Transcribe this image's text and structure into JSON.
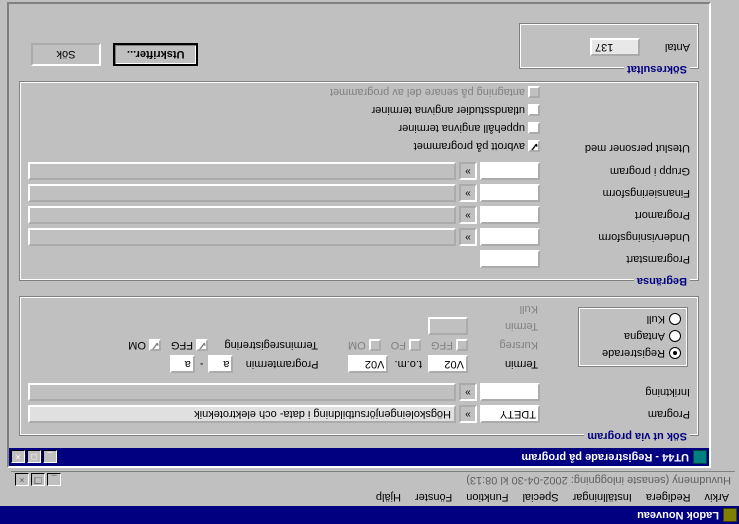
{
  "app": {
    "title": "Ladok Nouveau",
    "menu": [
      "Arkiv",
      "Redigera",
      "Inställningar",
      "Special",
      "Funktion",
      "Fönster",
      "Hjälp"
    ],
    "status": "Huvudmeny   (senaste inloggning: 2002-04-30 kl 08:13)"
  },
  "child": {
    "title": "UT44 - Registrerade på program"
  },
  "sok": {
    "legend": "Sök ut via program",
    "program_label": "Program",
    "program_code": "TDETY",
    "program_desc": "Högskoleingenjörsutbildning i data- och elektroteknik",
    "inriktning_label": "Inriktning",
    "inriktning_code": "",
    "inriktning_desc": "",
    "radios": {
      "registrerade": "Registrerade",
      "antagna": "Antagna",
      "kull": "Kull"
    },
    "termin_label": "Termin",
    "termin_from": "V02",
    "termin_tom_label": "t.o.m.",
    "termin_to": "V02",
    "programtermin_label": "Programtermin",
    "programtermin_from": "a",
    "programtermin_dash": "-",
    "programtermin_to": "a",
    "kursreg_label": "Kursreg",
    "ffg": "FFG",
    "fo": "FO",
    "om": "OM",
    "terminsreg_label": "Terminsregistrering",
    "kull_small_label": "Termin",
    "kull_small_label2": "Kull"
  },
  "begr": {
    "legend": "Begränsa",
    "programstart_label": "Programstart",
    "undervisningsform_label": "Undervisningsform",
    "programort_label": "Programort",
    "finansieringsform_label": "Finansieringsform",
    "grupp_label": "Grupp i program",
    "uteslut_label": "Uteslut personer med",
    "cb_avbrott": "avbrott på programmet",
    "cb_uppehall": "uppehåll angivna terminer",
    "cb_utlands": "utlandsstudier angivna terminer",
    "cb_antagning": "antagning på senare del av programmet"
  },
  "actions": {
    "utskrifter": "Utskrifter...",
    "sok": "Sök"
  },
  "res": {
    "legend": "Sökresultat",
    "antal_label": "Antal",
    "antal_value": "137"
  }
}
